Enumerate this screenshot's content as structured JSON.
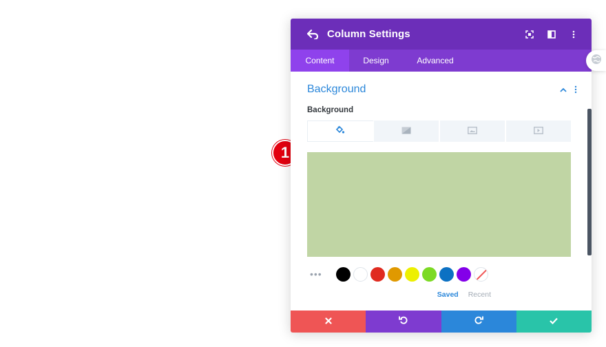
{
  "step_badge": "1",
  "modal": {
    "title": "Column Settings",
    "tabs": [
      {
        "label": "Content",
        "active": true
      },
      {
        "label": "Design",
        "active": false
      },
      {
        "label": "Advanced",
        "active": false
      }
    ],
    "section_title": "Background",
    "field_label": "Background",
    "background_tabs": [
      "paint-bucket-icon",
      "gradient-icon",
      "image-icon",
      "video-icon"
    ],
    "selected_color": "#c0d5a4",
    "palette": [
      {
        "name": "black",
        "color": "#000000"
      },
      {
        "name": "white",
        "color": "#ffffff"
      },
      {
        "name": "red",
        "color": "#e02b20"
      },
      {
        "name": "orange",
        "color": "#e09900"
      },
      {
        "name": "yellow",
        "color": "#edf000"
      },
      {
        "name": "green",
        "color": "#7cda24"
      },
      {
        "name": "blue",
        "color": "#0c71c3"
      },
      {
        "name": "purple",
        "color": "#8300e9"
      }
    ],
    "palette_tabs": {
      "saved": "Saved",
      "recent": "Recent"
    },
    "footer": [
      "close-icon",
      "undo-icon",
      "redo-icon",
      "check-icon"
    ]
  },
  "colors": {
    "header": "#6c2eb9",
    "tabs": "#7e3bd0",
    "accent_blue": "#2b87da"
  }
}
